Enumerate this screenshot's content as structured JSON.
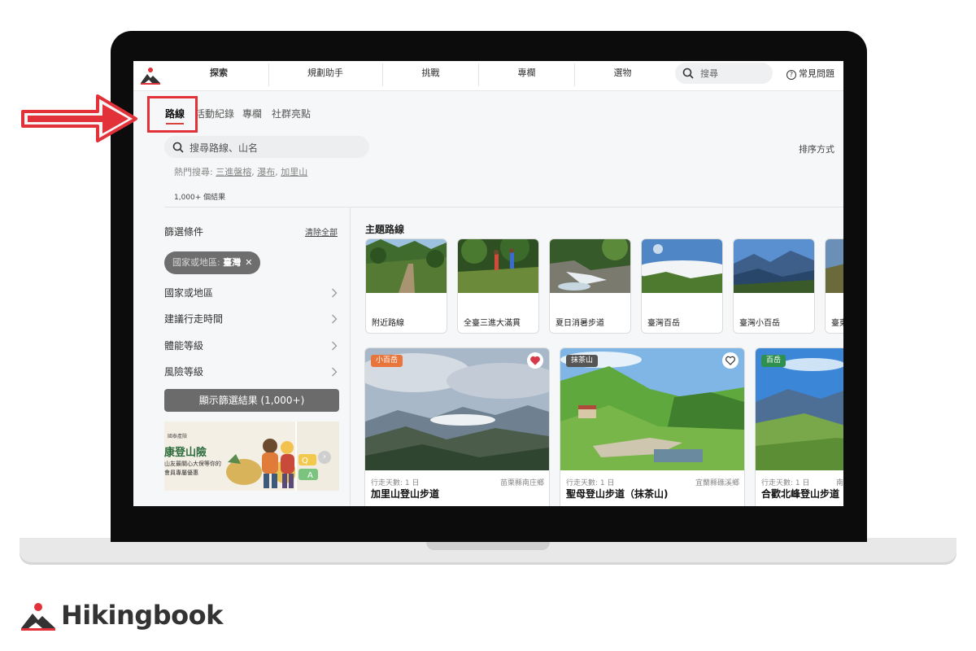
{
  "nav": {
    "items": [
      "探索",
      "規劃助手",
      "挑戰",
      "專欄",
      "選物"
    ],
    "search_placeholder": "搜尋",
    "faq": "常見問題"
  },
  "tabs": [
    "路線",
    "活動紀錄",
    "專欄",
    "社群亮點"
  ],
  "active_tab": "路線",
  "search": {
    "placeholder": "搜尋路線、山名",
    "sort": "排序方式",
    "hot_label": "熱門搜尋: ",
    "hot_keywords": [
      "三進盤榕",
      "瀑布",
      "加里山"
    ],
    "result_count": "1,000+ 個結果"
  },
  "filters": {
    "title": "篩選條件",
    "clear_all": "清除全部",
    "chip_key": "國家或地區: ",
    "chip_value": "臺灣",
    "rows": [
      "國家或地區",
      "建議行走時間",
      "體能等級",
      "風險等級"
    ],
    "show_button": "顯示篩選結果 (1,000+)"
  },
  "promo": {
    "small": "國泰產險",
    "big": "康登山險",
    "line1": "山友最關心大保等你的",
    "line2": "會員專屬優惠"
  },
  "theme": {
    "title": "主題路線",
    "cards": [
      "附近路線",
      "全臺三進大滿貫",
      "夏日消暑步道",
      "臺灣百岳",
      "臺灣小百岳",
      "臺東"
    ]
  },
  "routes": [
    {
      "badge": "小百岳",
      "badge_color": "#e8763c",
      "liked": true,
      "days": "行走天數: 1 日",
      "location": "苗栗縣南庄鄉",
      "title": "加里山登山步道"
    },
    {
      "badge": "抹茶山",
      "badge_color": "#555555",
      "liked": false,
      "days": "行走天數: 1 日",
      "location": "宜蘭縣礁溪鄉",
      "title": "聖母登山步道（抹茶山)"
    },
    {
      "badge": "百岳",
      "badge_color": "#2f8f4e",
      "liked": false,
      "days": "行走天數: 1 日",
      "location": "南",
      "title": "合歡北峰登山步道"
    }
  ],
  "brand": {
    "name": "Hikingbook"
  },
  "colors": {
    "accent": "#d94141",
    "annotation": "#e3313a"
  }
}
